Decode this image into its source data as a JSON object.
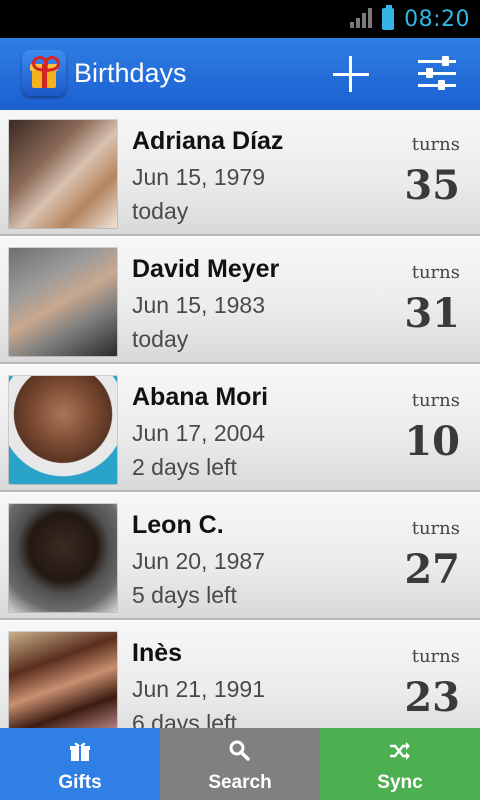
{
  "status_bar": {
    "time": "08:20",
    "accent_color": "#33b5e5"
  },
  "action_bar": {
    "title": "Birthdays",
    "app_icon": "gift-icon",
    "add_icon": "plus-icon",
    "settings_icon": "sliders-icon",
    "color": "#2f7fe4"
  },
  "birthdays": [
    {
      "name": "Adriana Díaz",
      "date": "Jun 15, 1979",
      "remaining": "today",
      "turns_label": "turns",
      "age": "35"
    },
    {
      "name": "David Meyer",
      "date": "Jun 15, 1983",
      "remaining": "today",
      "turns_label": "turns",
      "age": "31"
    },
    {
      "name": "Abana Mori",
      "date": "Jun 17, 2004",
      "remaining": "2 days left",
      "turns_label": "turns",
      "age": "10"
    },
    {
      "name": "Leon C.",
      "date": "Jun 20, 1987",
      "remaining": "5 days left",
      "turns_label": "turns",
      "age": "27"
    },
    {
      "name": "Inès",
      "date": "Jun 21, 1991",
      "remaining": "6 days left",
      "turns_label": "turns",
      "age": "23"
    }
  ],
  "bottom_tabs": [
    {
      "label": "Gifts",
      "icon": "gift-icon",
      "color": "#2f7fe4"
    },
    {
      "label": "Search",
      "icon": "search-icon",
      "color": "#808080"
    },
    {
      "label": "Sync",
      "icon": "shuffle-icon",
      "color": "#4caf50"
    }
  ]
}
